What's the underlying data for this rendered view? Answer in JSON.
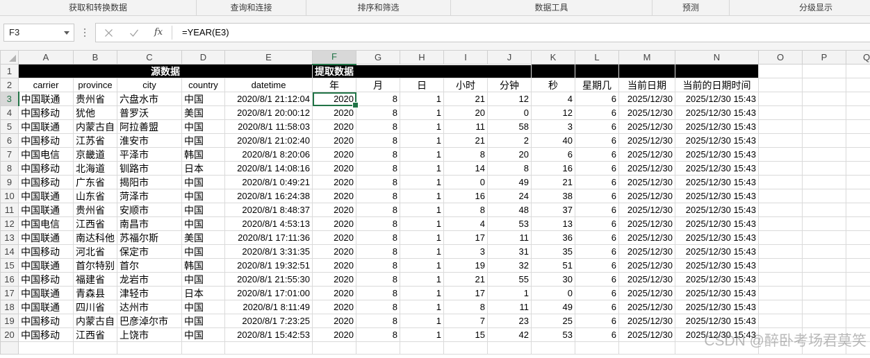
{
  "ribbon": {
    "groups": [
      "获取和转换数据",
      "查询和连接",
      "排序和筛选",
      "数据工具",
      "预测",
      "分级显示"
    ]
  },
  "formula_bar": {
    "name_box": "F3",
    "function_label": "fx",
    "formula": "=YEAR(E3)",
    "icons": {
      "dropdown": "chevron-down-icon",
      "more": "more-options-icon",
      "cancel": "close-icon",
      "enter": "check-icon"
    }
  },
  "sheet": {
    "columns": [
      "A",
      "B",
      "C",
      "D",
      "E",
      "F",
      "G",
      "H",
      "I",
      "J",
      "K",
      "L",
      "M",
      "N",
      "O",
      "P",
      "Q"
    ],
    "row_numbers": [
      1,
      2,
      3,
      4,
      5,
      6,
      7,
      8,
      9,
      10,
      11,
      12,
      13,
      14,
      15,
      16,
      17,
      18,
      19,
      20
    ],
    "section_headers": {
      "source": "源数据",
      "extract": "提取数据"
    },
    "headers": [
      "carrier",
      "province",
      "city",
      "country",
      "datetime",
      "年",
      "月",
      "日",
      "小时",
      "分钟",
      "秒",
      "星期几",
      "当前日期",
      "当前的日期时间"
    ],
    "rows": [
      [
        "中国联通",
        "贵州省",
        "六盘水市",
        "中国",
        "2020/8/1 21:12:04",
        2020,
        8,
        1,
        21,
        12,
        4,
        6,
        "2025/12/30",
        "2025/12/30 15:43"
      ],
      [
        "中国移动",
        "犹他",
        "普罗沃",
        "美国",
        "2020/8/1 20:00:12",
        2020,
        8,
        1,
        20,
        0,
        12,
        6,
        "2025/12/30",
        "2025/12/30 15:43"
      ],
      [
        "中国联通",
        "内蒙古自",
        "阿拉善盟",
        "中国",
        "2020/8/1 11:58:03",
        2020,
        8,
        1,
        11,
        58,
        3,
        6,
        "2025/12/30",
        "2025/12/30 15:43"
      ],
      [
        "中国移动",
        "江苏省",
        "淮安市",
        "中国",
        "2020/8/1 21:02:40",
        2020,
        8,
        1,
        21,
        2,
        40,
        6,
        "2025/12/30",
        "2025/12/30 15:43"
      ],
      [
        "中国电信",
        "京畿道",
        "平泽市",
        "韩国",
        "2020/8/1 8:20:06",
        2020,
        8,
        1,
        8,
        20,
        6,
        6,
        "2025/12/30",
        "2025/12/30 15:43"
      ],
      [
        "中国移动",
        "北海道",
        "钏路市",
        "日本",
        "2020/8/1 14:08:16",
        2020,
        8,
        1,
        14,
        8,
        16,
        6,
        "2025/12/30",
        "2025/12/30 15:43"
      ],
      [
        "中国移动",
        "广东省",
        "揭阳市",
        "中国",
        "2020/8/1 0:49:21",
        2020,
        8,
        1,
        0,
        49,
        21,
        6,
        "2025/12/30",
        "2025/12/30 15:43"
      ],
      [
        "中国联通",
        "山东省",
        "菏泽市",
        "中国",
        "2020/8/1 16:24:38",
        2020,
        8,
        1,
        16,
        24,
        38,
        6,
        "2025/12/30",
        "2025/12/30 15:43"
      ],
      [
        "中国联通",
        "贵州省",
        "安顺市",
        "中国",
        "2020/8/1 8:48:37",
        2020,
        8,
        1,
        8,
        48,
        37,
        6,
        "2025/12/30",
        "2025/12/30 15:43"
      ],
      [
        "中国电信",
        "江西省",
        "南昌市",
        "中国",
        "2020/8/1 4:53:13",
        2020,
        8,
        1,
        4,
        53,
        13,
        6,
        "2025/12/30",
        "2025/12/30 15:43"
      ],
      [
        "中国联通",
        "南达科他",
        "苏福尔斯",
        "美国",
        "2020/8/1 17:11:36",
        2020,
        8,
        1,
        17,
        11,
        36,
        6,
        "2025/12/30",
        "2025/12/30 15:43"
      ],
      [
        "中国移动",
        "河北省",
        "保定市",
        "中国",
        "2020/8/1 3:31:35",
        2020,
        8,
        1,
        3,
        31,
        35,
        6,
        "2025/12/30",
        "2025/12/30 15:43"
      ],
      [
        "中国联通",
        "首尔特别",
        "首尔",
        "韩国",
        "2020/8/1 19:32:51",
        2020,
        8,
        1,
        19,
        32,
        51,
        6,
        "2025/12/30",
        "2025/12/30 15:43"
      ],
      [
        "中国移动",
        "福建省",
        "龙岩市",
        "中国",
        "2020/8/1 21:55:30",
        2020,
        8,
        1,
        21,
        55,
        30,
        6,
        "2025/12/30",
        "2025/12/30 15:43"
      ],
      [
        "中国联通",
        "青森县",
        "津轻市",
        "日本",
        "2020/8/1 17:01:00",
        2020,
        8,
        1,
        17,
        1,
        0,
        6,
        "2025/12/30",
        "2025/12/30 15:43"
      ],
      [
        "中国联通",
        "四川省",
        "达州市",
        "中国",
        "2020/8/1 8:11:49",
        2020,
        8,
        1,
        8,
        11,
        49,
        6,
        "2025/12/30",
        "2025/12/30 15:43"
      ],
      [
        "中国移动",
        "内蒙古自",
        "巴彦淖尔市",
        "中国",
        "2020/8/1 7:23:25",
        2020,
        8,
        1,
        7,
        23,
        25,
        6,
        "2025/12/30",
        "2025/12/30 15:43"
      ],
      [
        "中国移动",
        "江西省",
        "上饶市",
        "中国",
        "2020/8/1 15:42:53",
        2020,
        8,
        1,
        15,
        42,
        53,
        6,
        "2025/12/30",
        "2025/12/30 15:43"
      ]
    ]
  },
  "watermark": "CSDN @醉卧考场君莫笑",
  "colors": {
    "accent": "#217346",
    "section_fill": "#000000",
    "section_text": "#ffffff",
    "gridline": "#dadada"
  }
}
